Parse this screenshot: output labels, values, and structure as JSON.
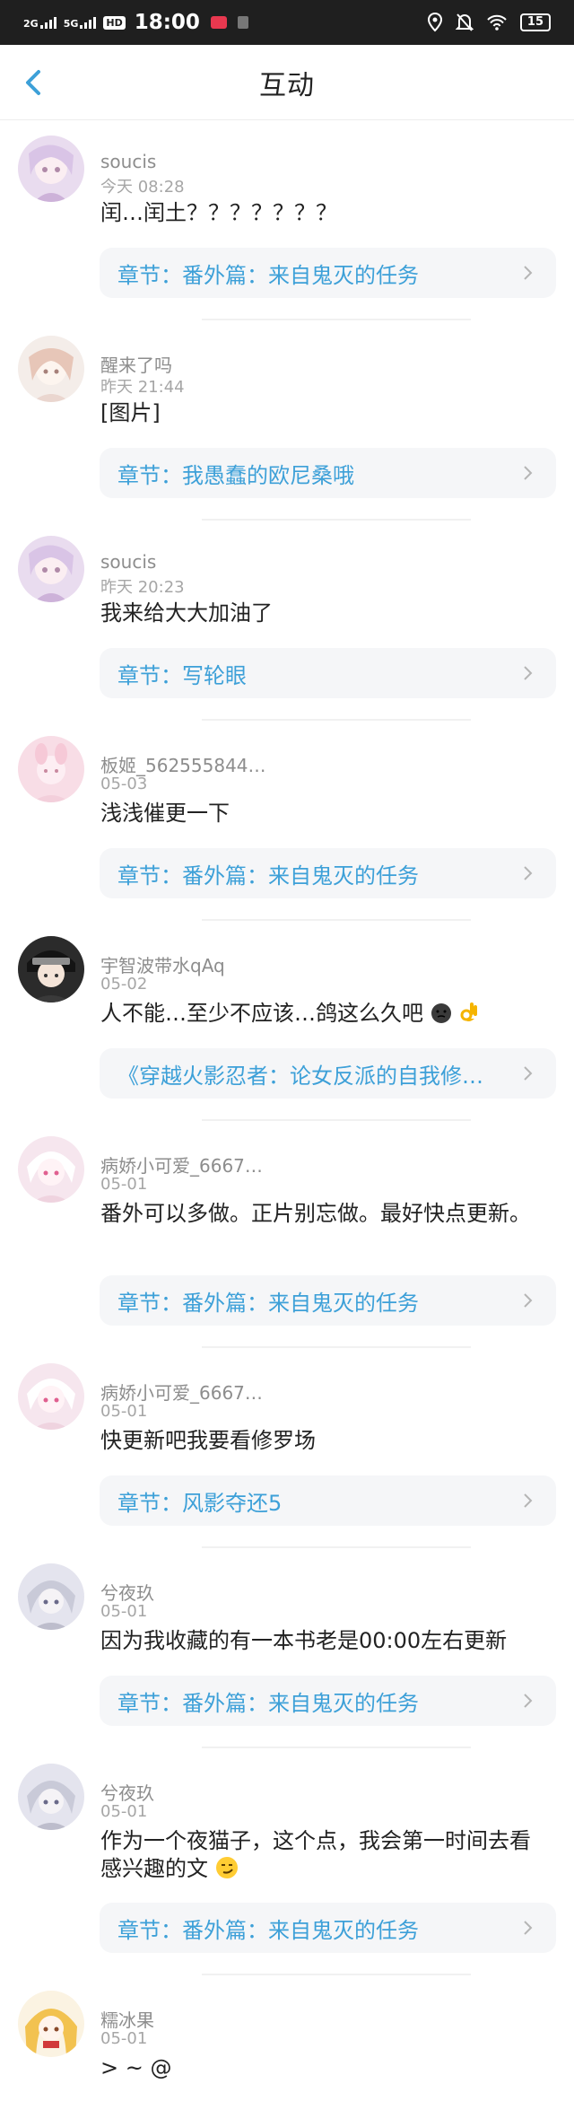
{
  "status_bar": {
    "signal1": "2G",
    "signal2": "5G",
    "hd": "HD",
    "time": "18:00",
    "battery": "15"
  },
  "header": {
    "title": "互动"
  },
  "comments": [
    {
      "user": "soucis",
      "date": "今天 08:28",
      "text": "闰…闰土？？？？？？？",
      "chapter": "章节：番外篇：来自鬼灭的任务"
    },
    {
      "user": "醒来了吗",
      "date": "昨天 21:44",
      "text": "[图片]",
      "chapter": "章节：我愚蠢的欧尼桑哦"
    },
    {
      "user": "soucis",
      "date": "昨天 20:23",
      "text": "我来给大大加油了",
      "chapter": "章节：写轮眼"
    },
    {
      "user": "板姬_562555844…",
      "date": "05-03",
      "text": "浅浅催更一下",
      "chapter": "章节：番外篇：来自鬼灭的任务"
    },
    {
      "user": "宇智波带水qAq",
      "date": "05-02",
      "text": "人不能…至少不应该…鸽这么久吧",
      "chapter": "《穿越火影忍者：论女反派的自我修…"
    },
    {
      "user": "病娇小可爱_6667…",
      "date": "05-01",
      "text": "番外可以多做。正片别忘做。最好快点更新。",
      "chapter": "章节：番外篇：来自鬼灭的任务"
    },
    {
      "user": "病娇小可爱_6667…",
      "date": "05-01",
      "text": "快更新吧我要看修罗场",
      "chapter": "章节：风影夺还5"
    },
    {
      "user": "兮夜玖",
      "date": "05-01",
      "text": "因为我收藏的有一本书老是00:00左右更新",
      "chapter": "章节：番外篇：来自鬼灭的任务"
    },
    {
      "user": "兮夜玖",
      "date": "05-01",
      "text": "作为一个夜猫子，这个点，我会第一时间去看感兴趣的文",
      "chapter": "章节：番外篇：来自鬼灭的任务"
    },
    {
      "user": "糯冰果",
      "date": "05-01",
      "text": "> ~ @",
      "chapter": ""
    }
  ],
  "colors": {
    "accent": "#3da0d8",
    "chapter_bg": "#f5f6f8",
    "meta": "#8d8d8d"
  }
}
